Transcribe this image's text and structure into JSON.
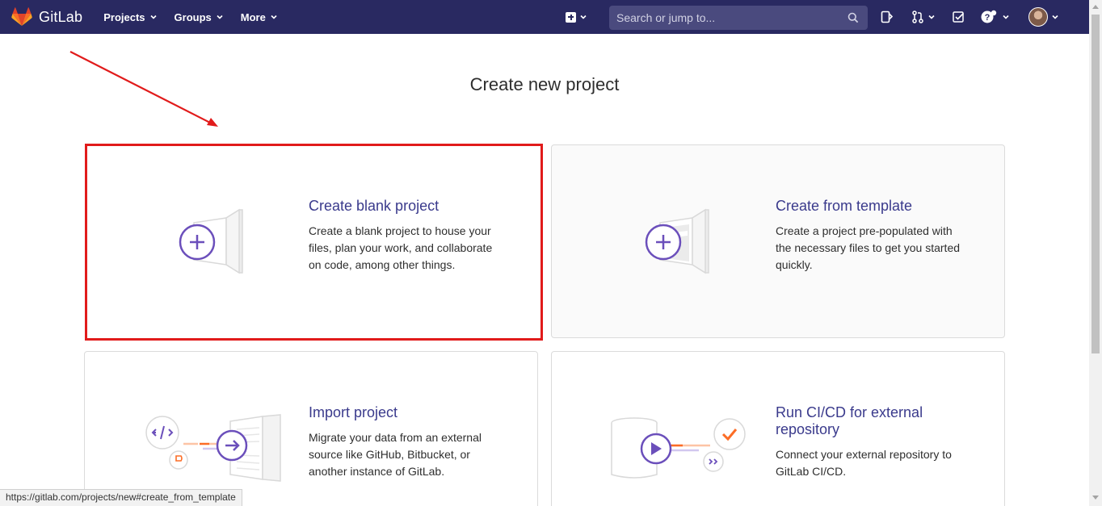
{
  "brand": {
    "name": "GitLab"
  },
  "nav": {
    "items": [
      {
        "label": "Projects"
      },
      {
        "label": "Groups"
      },
      {
        "label": "More"
      }
    ]
  },
  "search": {
    "placeholder": "Search or jump to..."
  },
  "page": {
    "title": "Create new project"
  },
  "cards": [
    {
      "title": "Create blank project",
      "description": "Create a blank project to house your files, plan your work, and collaborate on code, among other things."
    },
    {
      "title": "Create from template",
      "description": "Create a project pre-populated with the necessary files to get you started quickly."
    },
    {
      "title": "Import project",
      "description": "Migrate your data from an external source like GitHub, Bitbucket, or another instance of GitLab."
    },
    {
      "title": "Run CI/CD for external repository",
      "description": "Connect your external repository to GitLab CI/CD."
    }
  ],
  "status_bar": {
    "url": "https://gitlab.com/projects/new#create_from_template"
  },
  "colors": {
    "navbar": "#292961",
    "accent": "#6b4fbb",
    "link": "#3a3a8c",
    "annotation": "#e11b1b",
    "orange": "#fc6d26"
  }
}
